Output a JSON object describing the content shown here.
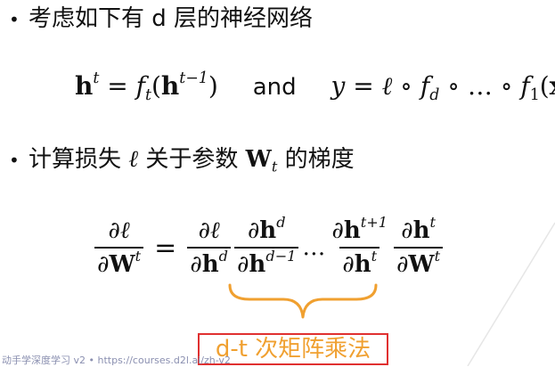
{
  "bullets": {
    "dot": "•",
    "b1": "考虑如下有 d 层的神经网络",
    "b2_prefix": "计算损失",
    "b2_ell": "ℓ",
    "b2_middle": "关于参数",
    "b2_W": "W",
    "b2_t": "t",
    "b2_suffix": "的梯度"
  },
  "eq1": {
    "h": "h",
    "t": "t",
    "eq": " = ",
    "f": "f",
    "lp": "(",
    "tm1": "t−1",
    "rp": ")",
    "and": "and",
    "y": "y",
    "ell": "ℓ",
    "comp": " ∘ ",
    "d": "d",
    "ellipsis": "…",
    "one": "1",
    "x": "x"
  },
  "eq2": {
    "partial": "∂",
    "ell": "ℓ",
    "W": "W",
    "h": "h",
    "t": "t",
    "d": "d",
    "dm1": "d−1",
    "tp1": "t+1",
    "equals": "=",
    "dots": "…"
  },
  "note": {
    "text": "d-t 次矩阵乘法"
  },
  "footer": {
    "text": "动手学深度学习 v2 • https://courses.d2l.ai/zh-v2"
  },
  "colors": {
    "brace": "#f0a030",
    "box_border": "#e03030",
    "note_text": "#f0a030",
    "footer_text": "#8a8fb0"
  }
}
